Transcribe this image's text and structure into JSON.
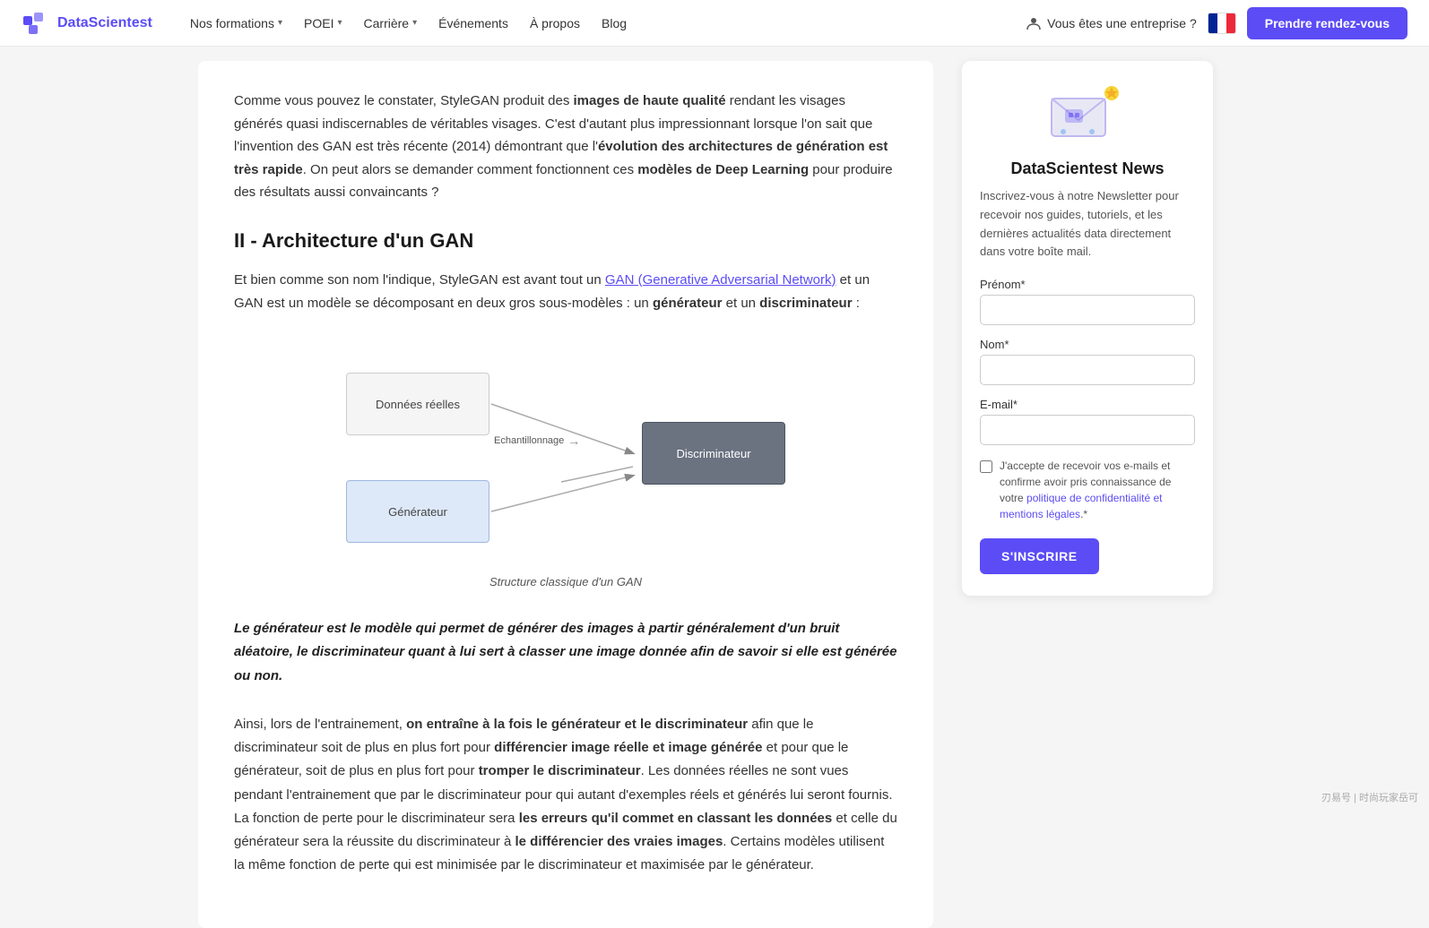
{
  "navbar": {
    "logo_text": "DataScientest",
    "nav_formations": "Nos formations",
    "nav_poei": "POEI",
    "nav_carriere": "Carrière",
    "nav_evenements": "Événements",
    "nav_apropos": "À propos",
    "nav_blog": "Blog",
    "enterprise_label": "Vous êtes une entreprise ?",
    "cta_label": "Prendre rendez-vous"
  },
  "article": {
    "intro_text_1": "Comme vous pouvez le constater, StyleGAN produit des ",
    "intro_bold_1": "images de haute qualité",
    "intro_text_2": " rendant les visages générés quasi indiscernables de véritables visages. C'est d'autant plus impressionnant lorsque l'on sait que l'invention des GAN est très récente (2014) démontrant que l'",
    "intro_bold_2": "évolution des architectures de génération est très rapide",
    "intro_text_3": ". On peut alors se demander comment fonctionnent ces ",
    "intro_bold_3": "modèles de Deep Learning",
    "intro_text_4": " pour produire des résultats aussi convaincants ?",
    "section_heading": "II - Architecture d'un GAN",
    "body1_text1": "Et bien comme son nom l'indique, StyleGAN est avant tout un ",
    "body1_link": "GAN (Generative Adversarial Network)",
    "body1_text2": " et un GAN est un modèle se décomposant en deux gros sous-modèles : un ",
    "body1_bold1": "générateur",
    "body1_text3": " et un ",
    "body1_bold2": "discriminateur",
    "body1_text4": " :",
    "diagram_donnees": "Données réelles",
    "diagram_generateur": "Générateur",
    "diagram_discriminateur": "Discriminateur",
    "diagram_echantillonnage": "Echantillonnage",
    "diagram_caption": "Structure classique d'un GAN",
    "blockquote": "Le générateur est le modèle qui permet de générer des images à partir généralement d'un bruit aléatoire, le discriminateur quant à lui sert à classer une image donnée afin de savoir si elle est générée ou non.",
    "body2_text1": "Ainsi, lors de l'entrainement, ",
    "body2_bold1": "on entraîne à la fois le générateur et le discriminateur",
    "body2_text2": " afin que le discriminateur soit de plus en plus fort pour ",
    "body2_bold2": "différencier image réelle et image générée",
    "body2_text3": " et pour que le générateur, soit de plus en plus fort pour ",
    "body2_bold3": "tromper le discriminateur",
    "body2_text4": ". Les données réelles ne sont vues pendant l'entrainement que par le discriminateur pour qui autant d'exemples réels et générés lui seront fournis. La fonction de perte pour le discriminateur sera ",
    "body2_bold4": "les erreurs qu'il commet en classant les données",
    "body2_text5": " et celle du générateur sera la réussite du discriminateur à ",
    "body2_bold5": "le différencier des vraies images",
    "body2_text6": ". Certains modèles utilisent la même fonction de perte qui est minimisée par le discriminateur et maximisée par le générateur."
  },
  "newsletter": {
    "title": "DataScientest News",
    "description": "Inscrivez-vous à notre Newsletter pour recevoir nos guides, tutoriels, et les dernières actualités data directement dans votre boîte mail.",
    "prenom_label": "Prénom*",
    "nom_label": "Nom*",
    "email_label": "E-mail*",
    "prenom_placeholder": "",
    "nom_placeholder": "",
    "email_placeholder": "",
    "checkbox_text": "J'accepte de recevoir vos e-mails et confirme avoir pris connaissance de votre politique de confidentialité et mentions légales.*",
    "subscribe_label": "S'INSCRIRE"
  },
  "watermark": "刃易号 | 时尚玩家岳可"
}
